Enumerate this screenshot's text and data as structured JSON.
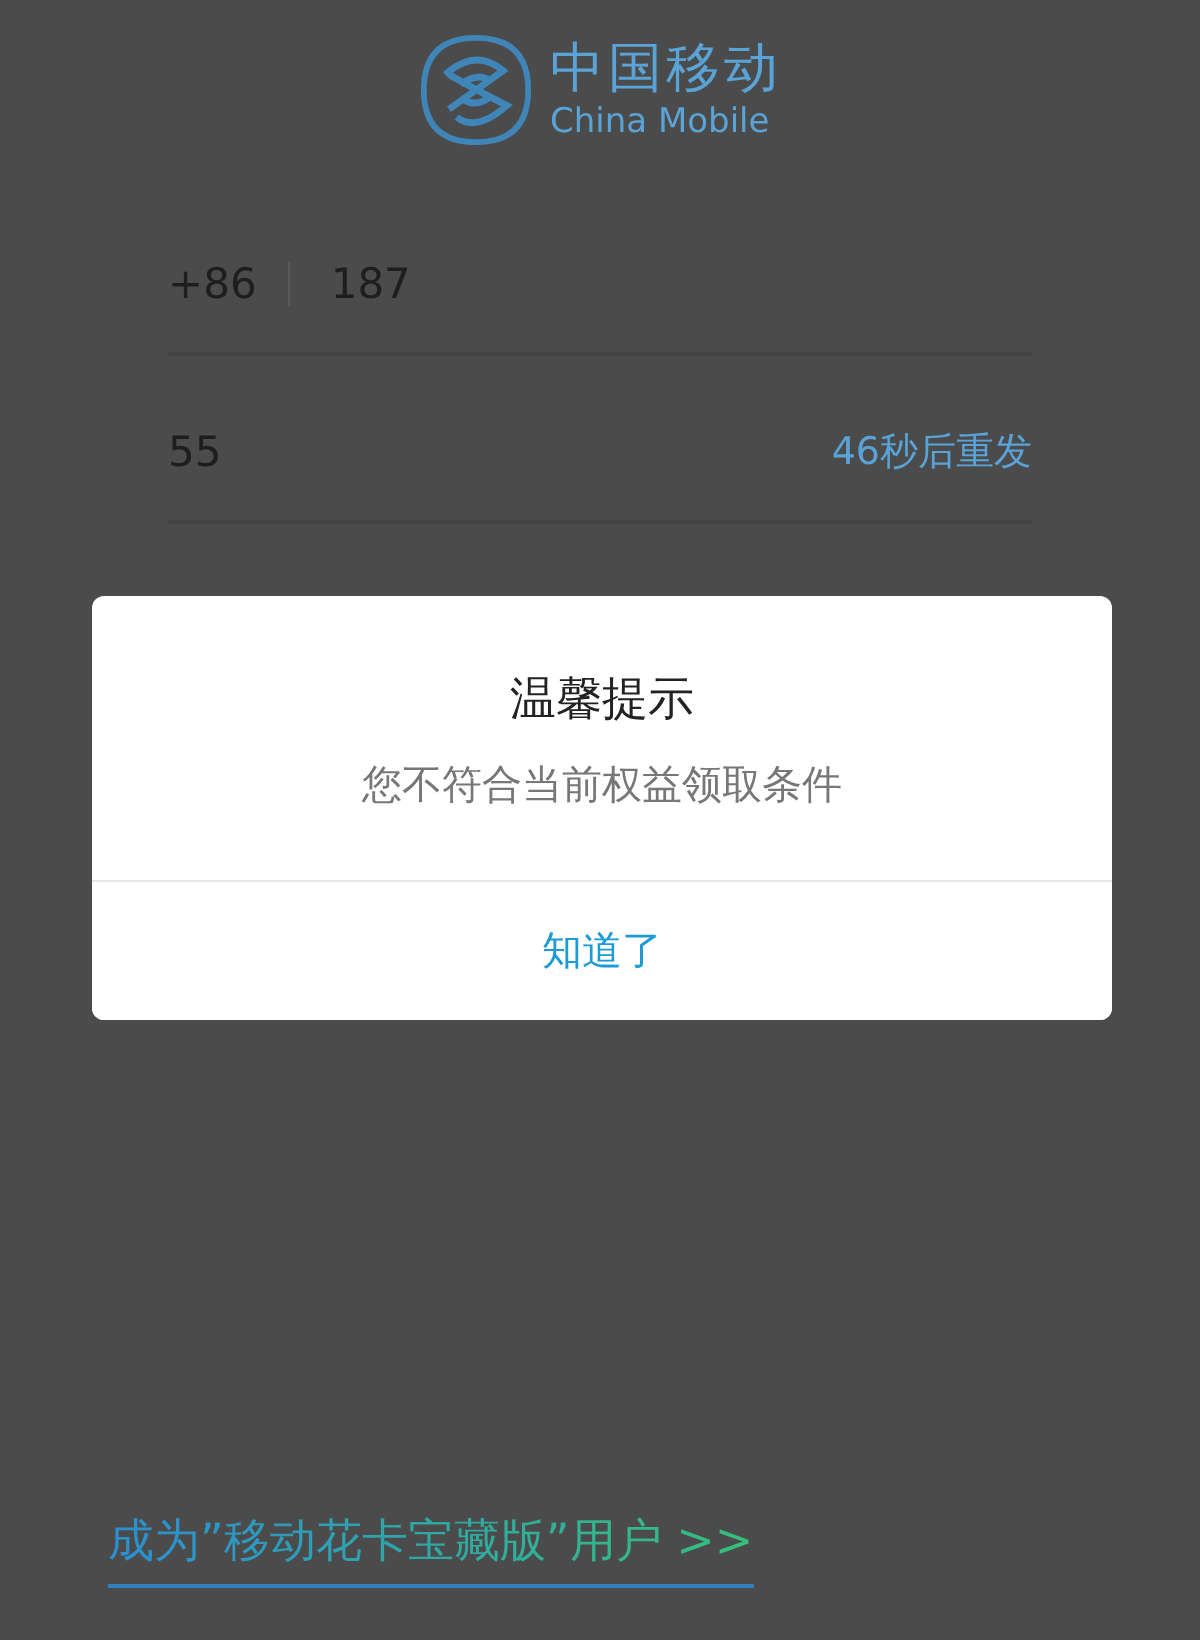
{
  "logo": {
    "name_zh": "中国移动",
    "name_en": "China Mobile"
  },
  "phone_field": {
    "country_code": "+86",
    "value": "187"
  },
  "code_field": {
    "value": "55",
    "resend": "46秒后重发"
  },
  "dialog": {
    "title": "温馨提示",
    "message": "您不符合当前权益领取条件",
    "button": "知道了"
  },
  "promo_link": {
    "text": "成为”移动花卡宝藏版”用户 >>"
  }
}
